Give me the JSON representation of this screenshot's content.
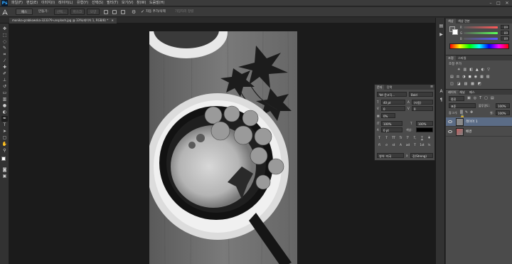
{
  "app": {
    "logo": "Ps"
  },
  "menu": [
    "파일(F)",
    "편집(E)",
    "이미지(I)",
    "레이어(L)",
    "유형(Y)",
    "선택(S)",
    "필터(T)",
    "보기(V)",
    "창(W)",
    "도움말(H)"
  ],
  "window_controls": {
    "minimize": "–",
    "maximize": "□",
    "close": "✕"
  },
  "options_bar": {
    "preset": "패스",
    "make": "만들기:",
    "selection": "선택...",
    "mask": "마스크",
    "shape": "모양",
    "auto_add_delete": "자동 추가/삭제",
    "align_edges": "가장자리 정렬"
  },
  "document": {
    "tab_title": "monika-grabkowska-323379-unsplash.jpg @ 33%(레이어 1, RGB/8) *"
  },
  "character_panel": {
    "tab_char": "문자",
    "tab_para": "단락",
    "font_family": "Yet 윤고딕...",
    "font_style": "Bold",
    "font_size": "40 pt",
    "leading": "(자동)",
    "kerning": "0",
    "tracking": "0",
    "scale_percent": "0%",
    "vertical_scale": "100%",
    "horizontal_scale": "100%",
    "baseline": "0 pt",
    "color_label": "색상:",
    "language": "영어: 미국",
    "antialias_icon": "a",
    "antialias": "강(Strong)",
    "style_buttons": [
      "T",
      "T",
      "TT",
      "Tr",
      "T'",
      "T,",
      "T",
      "T"
    ],
    "ot_buttons": [
      "fi",
      "σ",
      "st",
      "A",
      "ad",
      "T",
      "1st",
      "½"
    ]
  },
  "color_panel": {
    "tab_color": "색상",
    "tab_swatches": "색상 견본",
    "r": "89",
    "g": "89",
    "b": "89"
  },
  "adjustments_panel": {
    "tab_adjust": "조정",
    "tab_styles": "스타일",
    "title": "조정 추가"
  },
  "layers_panel": {
    "tabs": [
      "레이어",
      "채널",
      "패스"
    ],
    "filter": "종류",
    "blend_mode": "표준",
    "opacity_label": "불투명도:",
    "opacity": "100%",
    "lock_label": "잠그기:",
    "fill_label": "칠:",
    "fill": "100%",
    "layers": [
      {
        "name": "레이어 1",
        "selected": true
      },
      {
        "name": "배경",
        "selected": false
      }
    ]
  }
}
